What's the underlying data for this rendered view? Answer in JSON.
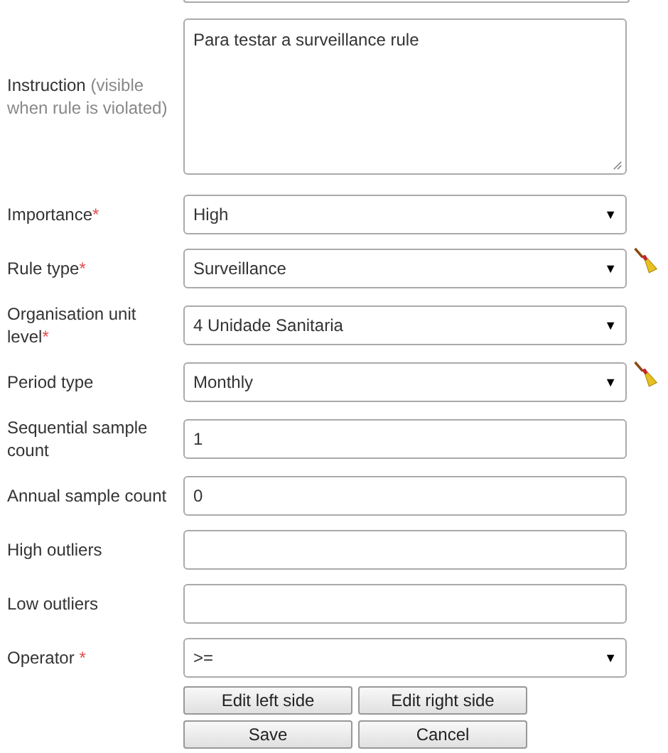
{
  "fields": [
    {
      "kind": "textarea",
      "label": "Instruction",
      "hint": "(visible when rule is violated)",
      "value": "Para testar a surveillance rule"
    },
    {
      "kind": "select",
      "label": "Importance",
      "required_mark": "*",
      "value": "High",
      "clearable": false
    },
    {
      "kind": "select",
      "label": "Rule type",
      "required_mark": "*",
      "value": "Surveillance",
      "clearable": true
    },
    {
      "kind": "select",
      "label": "Organisation unit level",
      "required_mark": "*",
      "value": "4 Unidade Sanitaria",
      "clearable": false
    },
    {
      "kind": "select",
      "label": "Period type",
      "value": "Monthly",
      "clearable": true
    },
    {
      "kind": "input",
      "label": "Sequential sample count",
      "value": "1"
    },
    {
      "kind": "input",
      "label": "Annual sample count",
      "value": "0"
    },
    {
      "kind": "input",
      "label": "High outliers"
    },
    {
      "kind": "input",
      "label": "Low outliers"
    },
    {
      "kind": "select",
      "label": "Operator ",
      "required_mark": "*",
      "value": ">=",
      "clearable": false
    }
  ],
  "button_rows": [
    [
      "Edit left side",
      "Edit right side"
    ],
    [
      "Save",
      "Cancel"
    ]
  ],
  "caret": "▼"
}
